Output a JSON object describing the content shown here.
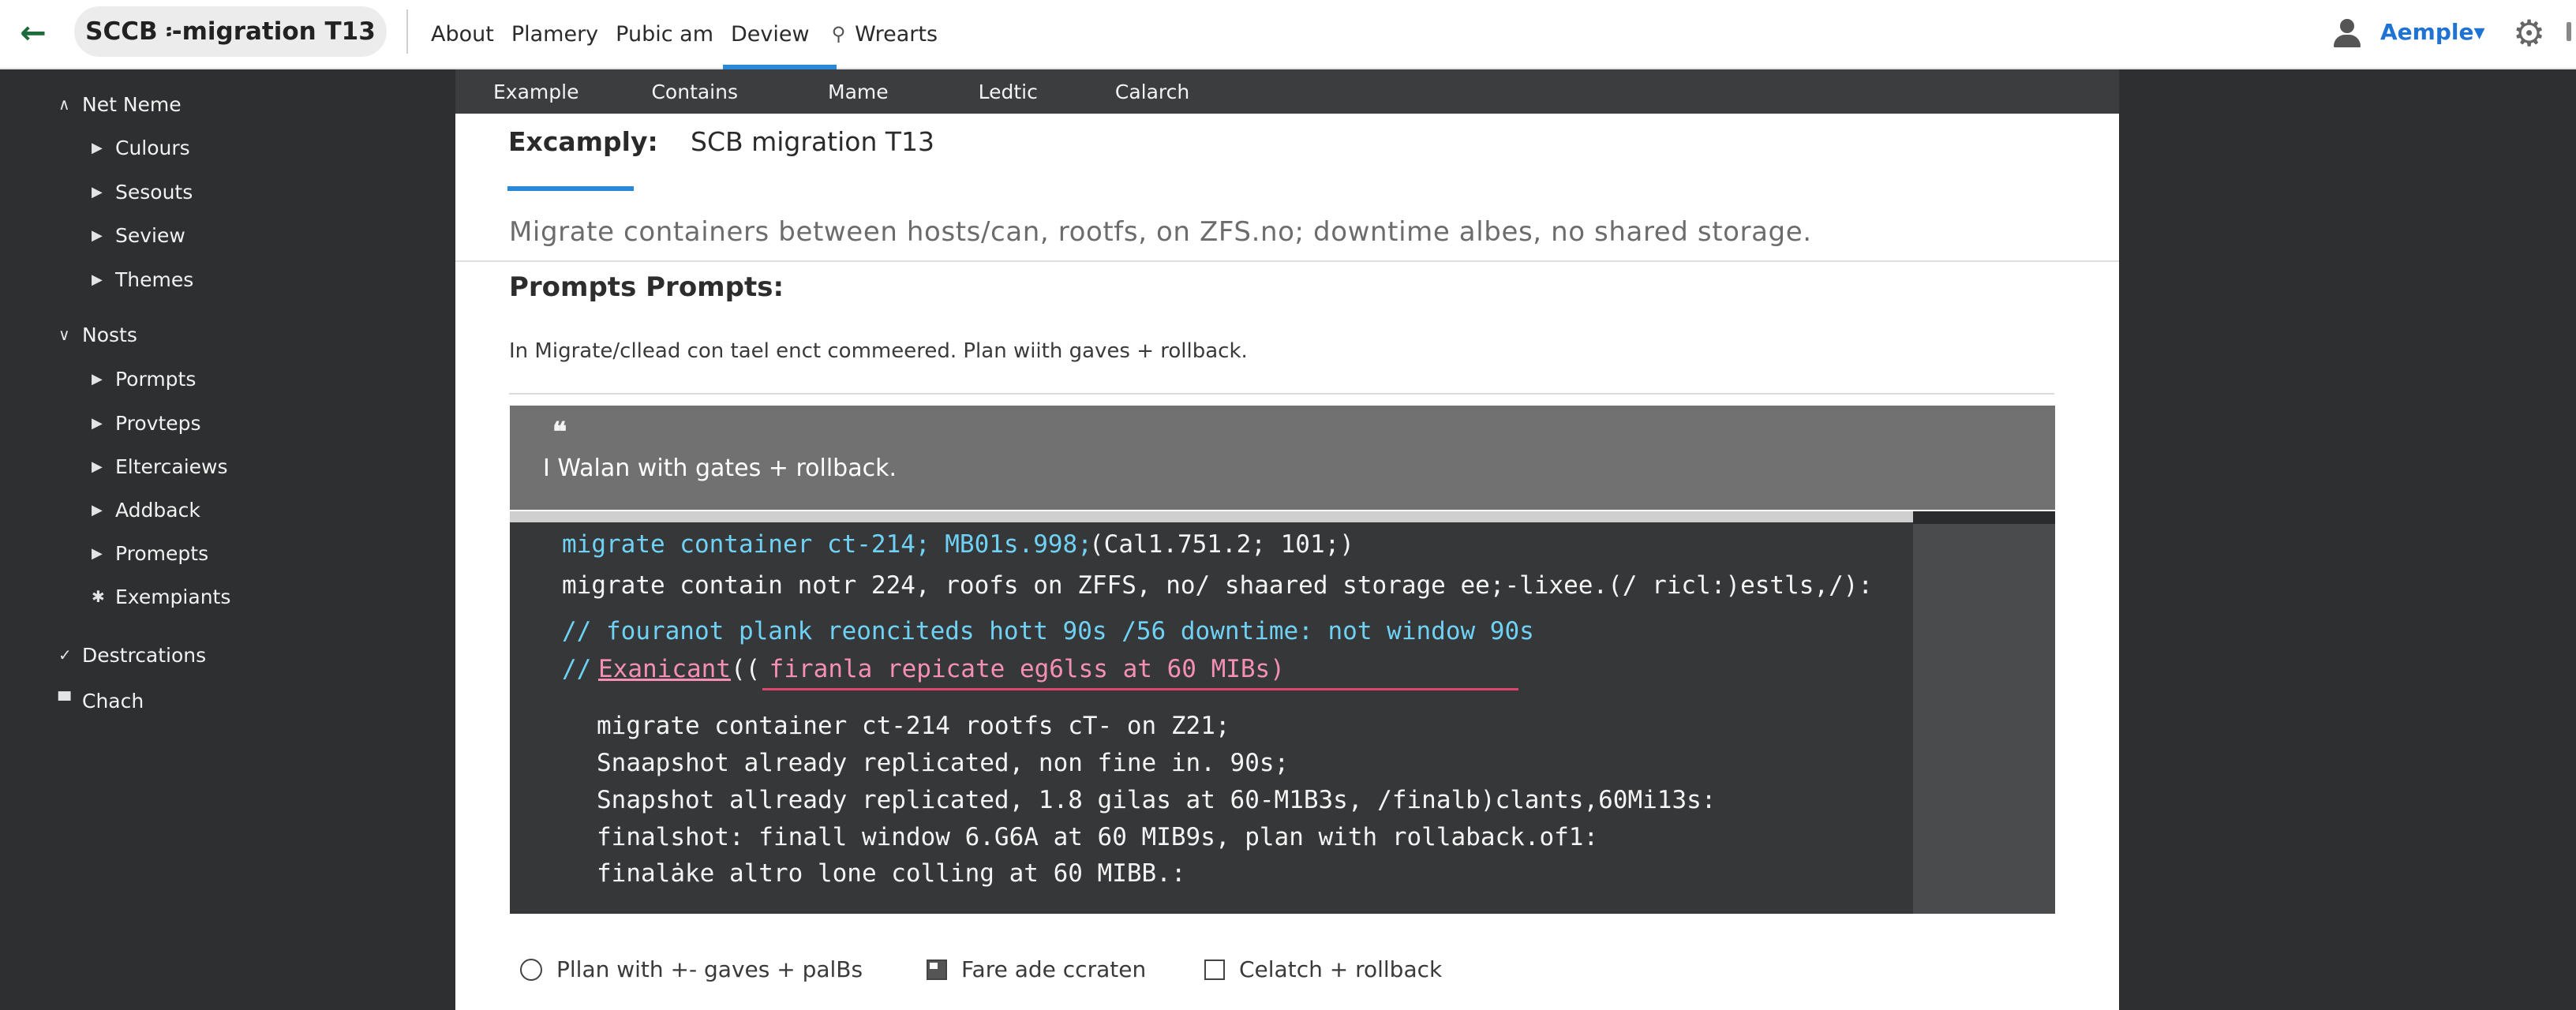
{
  "header": {
    "title": "SCCB ፡-migration T13",
    "nav": [
      "About",
      "Plamery",
      "Pubic am",
      "Deview"
    ],
    "active_nav": "Deview",
    "pinned_nav": "Wrearts",
    "user_name": "Aemple▾"
  },
  "sidebar": {
    "groups": [
      {
        "label": "Net Neme",
        "children": [
          "Culours",
          "Sesouts",
          "Seview",
          "Themes"
        ]
      },
      {
        "label": "Nosts",
        "children": [
          "Pormpts",
          "Provteps",
          "Eltercaiews",
          "Addback",
          "Promepts",
          "Exempiants"
        ]
      }
    ],
    "extra": [
      "Destrcations",
      "Chach"
    ]
  },
  "tabs": [
    "Example",
    "Contains",
    "Mame",
    "Ledtic",
    "Calarch"
  ],
  "subheader": {
    "label": "Excamply:",
    "title": "SCB migration T13"
  },
  "content": {
    "description": "Migrate containers between hosts/can, rootfs, on ZFS.no; downtime albes, no shared storage.",
    "section_heading": "Prompts Prompts:",
    "section_text": "In Migrate/cllead con tael enct commeered. Plan wiith gaves + rollback.",
    "quote_icon": "❝",
    "quote_text": "I Walan with gates + rollback."
  },
  "code": {
    "line1": "migrate container ct-214; MB01s.998;",
    "line1b": "(Cal1.751.2; 101;)",
    "line2": "migrate contain notr 224, roofs on ZFFS, no/ shaared storage ee;-lixee.(/ ricl:)estls,/):",
    "line3": "// fouranot plank reonciteds hott 90s /56 downtime: not window 90s",
    "line4_prefix": "// ",
    "line4_link": "Exanicant",
    "line4_paren": "((",
    "line4_rest": " firanla repicate eg6lss at 60 MIBs)",
    "line5": "migrate container ct-214 rootfs cT- on Z21;",
    "line6": "Snaapshot already replicated, non fine in. 90s;",
    "line7": "Snapshot allready replicated, 1.8 gilas at 60-M1B3s, /finalb)clants,60Mi13s:",
    "line8": "finalshot: finall window 6.G6A at 60 MIB9s, plan with rollaback.of1:",
    "line9": "finalȧke altro lone colling at 60 MIBB.:"
  },
  "options": [
    {
      "type": "radio",
      "label": "Pllan with +- gaves + palBs",
      "checked": false
    },
    {
      "type": "checkbox",
      "label": "Fare ade ccraten",
      "checked": true
    },
    {
      "type": "checkbox",
      "label": "Celatch + rollback",
      "checked": false
    }
  ],
  "colors": {
    "accent": "#2a88d6",
    "user_link": "#1f73d2",
    "code_cyan": "#6fd2f5",
    "code_pink": "#f58fb6",
    "back_arrow": "#1d6b3a"
  },
  "icons": {
    "back": "arrow-left-icon",
    "pin": "pin-icon",
    "user": "user-icon",
    "settings": "gear-icon",
    "quote": "quote-icon"
  }
}
